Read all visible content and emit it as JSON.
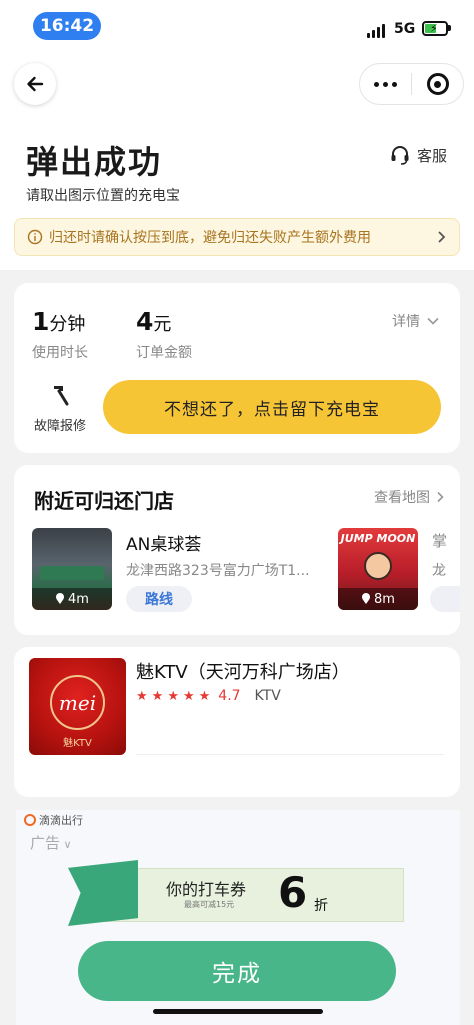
{
  "status_bar": {
    "time": "16:42",
    "network": "5G"
  },
  "header": {
    "title": "弹出成功",
    "subtitle": "请取出图示位置的充电宝",
    "customer_service_label": "客服"
  },
  "notice": {
    "text": "归还时请确认按压到底，避免归还失败产生额外费用"
  },
  "order": {
    "duration_value": "1",
    "duration_unit": "分钟",
    "duration_label": "使用时长",
    "amount_value": "4",
    "amount_unit": "元",
    "amount_label": "订单金额",
    "detail_label": "详情",
    "repair_label": "故障报修",
    "keep_button_label": "不想还了，点击留下充电宝"
  },
  "nearby": {
    "title": "附近可归还门店",
    "map_link": "查看地图",
    "stores": [
      {
        "name": "AN桌球荟",
        "address": "龙津西路323号富力广场T1...",
        "distance": "4m",
        "route_label": "路线"
      },
      {
        "distance": "8m",
        "banner_text": "JUMP MOON",
        "peek_name": "掌",
        "peek_address": "龙"
      }
    ]
  },
  "ktv": {
    "name": "魅KTV（天河万科广场店）",
    "logo_text": "mei",
    "logo_sub": "魅KTV",
    "rating": "4.7",
    "category": "KTV",
    "stars": 5
  },
  "ad": {
    "brand": "滴滴出行",
    "label": "广告",
    "coupon_text": "你的打车券",
    "coupon_small": "最高可减15元",
    "coupon_value": "6",
    "coupon_unit": "折",
    "done_label": "完成"
  },
  "colors": {
    "accent_yellow": "#f6c535",
    "notice_text": "#a8741f",
    "route_blue": "#3b77d8",
    "rating_red": "#e53935",
    "done_green": "#49b68a"
  }
}
